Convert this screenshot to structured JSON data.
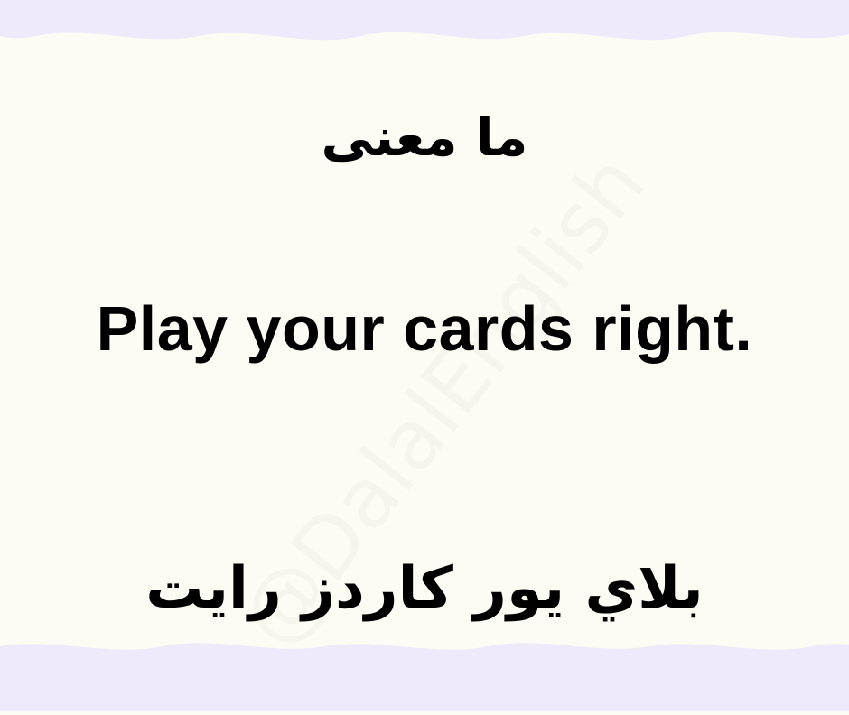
{
  "colors": {
    "background": "#fcfcf4",
    "band": "#eeeafb",
    "text": "#000000"
  },
  "card": {
    "question": "ما معنى",
    "phrase": "Play your cards right.",
    "transliteration": "بلاي يور كاردز رايت"
  },
  "watermark": {
    "text": "@DalalEnglish"
  }
}
